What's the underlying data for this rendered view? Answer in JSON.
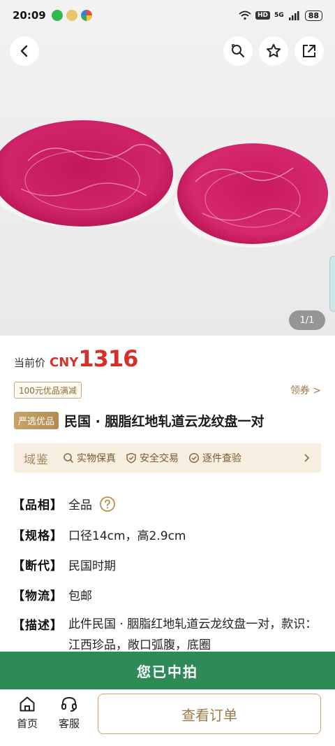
{
  "status_bar": {
    "time": "20:09",
    "hd": "HD",
    "network": "5G",
    "battery": "88"
  },
  "gallery": {
    "page_indicator": "1/1"
  },
  "price": {
    "label": "当前价",
    "currency": "CNY",
    "value": "1316",
    "color": "#d5312b"
  },
  "coupon": {
    "tag": "100元优品满减",
    "link": "领券 >"
  },
  "product": {
    "badge": "严选优品",
    "title": "民国 · 胭脂红地轧道云龙纹盘一对"
  },
  "guarantee": {
    "brand": "域鉴",
    "items": [
      "实物保真",
      "安全交易",
      "逐件查验"
    ]
  },
  "specs": [
    {
      "key": "【品相】",
      "value": "全品"
    },
    {
      "key": "【规格】",
      "value": "口径14cm，高2.9cm"
    },
    {
      "key": "【断代】",
      "value": "民国时期"
    },
    {
      "key": "【物流】",
      "value": "包邮"
    },
    {
      "key": "【描述】",
      "value": "此件民国 · 胭脂红地轧道云龙纹盘一对，款识：江西珍品，敞口弧腹，底圈"
    }
  ],
  "banner": {
    "text": "您已中拍",
    "color": "#2e8b57"
  },
  "bottom_nav": {
    "home": "首页",
    "service": "客服",
    "order_button": "查看订单"
  }
}
